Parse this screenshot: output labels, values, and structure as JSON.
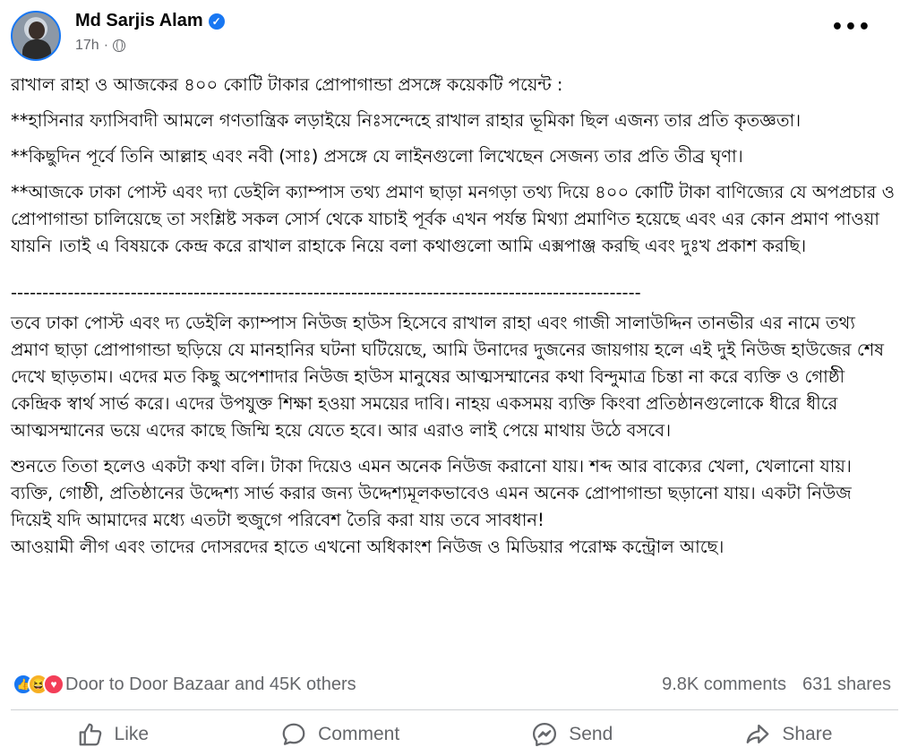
{
  "post": {
    "author": "Md Sarjis Alam",
    "time": "17h",
    "more_label": "•••",
    "paragraphs": [
      "রাখাল রাহা ও আজকের ৪০০ কোটি টাকার প্রোপাগান্ডা প্রসঙ্গে কয়েকটি পয়েন্ট :",
      "**হাসিনার ফ্যাসিবাদী আমলে গণতান্ত্রিক লড়াইয়ে নিঃসন্দেহে রাখাল রাহার ভূমিকা ছিল এজন্য তার প্রতি কৃতজ্ঞতা।",
      "**কিছুদিন পূর্বে তিনি আল্লাহ এবং নবী (সাঃ) প্রসঙ্গে যে লাইনগুলো লিখেছেন সেজন্য তার প্রতি তীব্র ঘৃণা।",
      "**আজকে ঢাকা পোস্ট এবং দ্যা ডেইলি ক্যাম্পাস তথ্য প্রমাণ ছাড়া মনগড়া তথ্য দিয়ে ৪০০ কোটি টাকা বাণিজ্যের যে অপপ্রচার ও প্রোপাগান্ডা চালিয়েছে তা সংশ্লিষ্ট সকল সোর্স থেকে যাচাই পূর্বক এখন পর্যন্ত মিথ্যা প্রমাণিত হয়েছে এবং এর কোন প্রমাণ পাওয়া যায়নি ।তাই এ বিষয়কে কেন্দ্র করে রাখাল রাহাকে নিয়ে বলা কথাগুলো আমি এক্সপাঞ্জ করছি এবং দুঃখ প্রকাশ করছি।"
    ],
    "divider": "----------------------------------------------------------------------------------------------------",
    "paragraphs_after": [
      "তবে ঢাকা পোস্ট এবং দ্য ডেইলি ক্যাম্পাস নিউজ হাউস হিসেবে রাখাল রাহা এবং গাজী সালাউদ্দিন তানভীর এর নামে তথ্য প্রমাণ ছাড়া প্রোপাগান্ডা ছড়িয়ে যে মানহানির ঘটনা ঘটিয়েছে, আমি উনাদের দুজনের জায়গায় হলে এই দুই নিউজ হাউজের শেষ দেখে ছাড়তাম। এদের মত কিছু অপেশাদার নিউজ হাউস মানুষের আত্মসম্মানের কথা বিন্দুমাত্র চিন্তা না করে ব্যক্তি ও গোষ্ঠী কেন্দ্রিক স্বার্থ সার্ভ করে। এদের উপযুক্ত শিক্ষা হওয়া সময়ের দাবি। নাহয় একসময় ব্যক্তি কিংবা প্রতিষ্ঠানগুলোকে ধীরে ধীরে আত্মসম্মানের ভয়ে এদের কাছে জিম্মি হয়ে যেতে হবে। আর এরাও লাই পেয়ে মাথায় উঠে বসবে।",
      "শুনতে তিতা হলেও একটা কথা বলি। টাকা দিয়েও এমন অনেক নিউজ করানো যায়। শব্দ আর বাক্যের খেলা, খেলানো যায়। ব্যক্তি, গোষ্ঠী, প্রতিষ্ঠানের উদ্দেশ্য সার্ভ করার জন্য উদ্দেশ্যমূলকভাবেও এমন অনেক প্রোপাগান্ডা ছড়ানো যায়। একটা নিউজ দিয়েই যদি আমাদের মধ্যে এতটা হুজুগে পরিবেশ তৈরি করা যায় তবে সাবধান!",
      "আওয়ামী লীগ এবং তাদের দোসরদের হাতে এখনো অধিকাংশ নিউজ ও মিডিয়ার পরোক্ষ কন্ট্রোল আছে।"
    ]
  },
  "reactions": {
    "summary": "Door to Door Bazaar and 45K others",
    "comments": "9.8K comments",
    "shares": "631 shares",
    "icons": [
      "like-reaction-icon",
      "haha-reaction-icon",
      "love-reaction-icon"
    ]
  },
  "actions": {
    "like": "Like",
    "comment": "Comment",
    "send": "Send",
    "share": "Share"
  },
  "colors": {
    "accent": "#1877f2",
    "secondary_text": "#65676b",
    "love": "#f33e58",
    "haha": "#f7b125"
  }
}
